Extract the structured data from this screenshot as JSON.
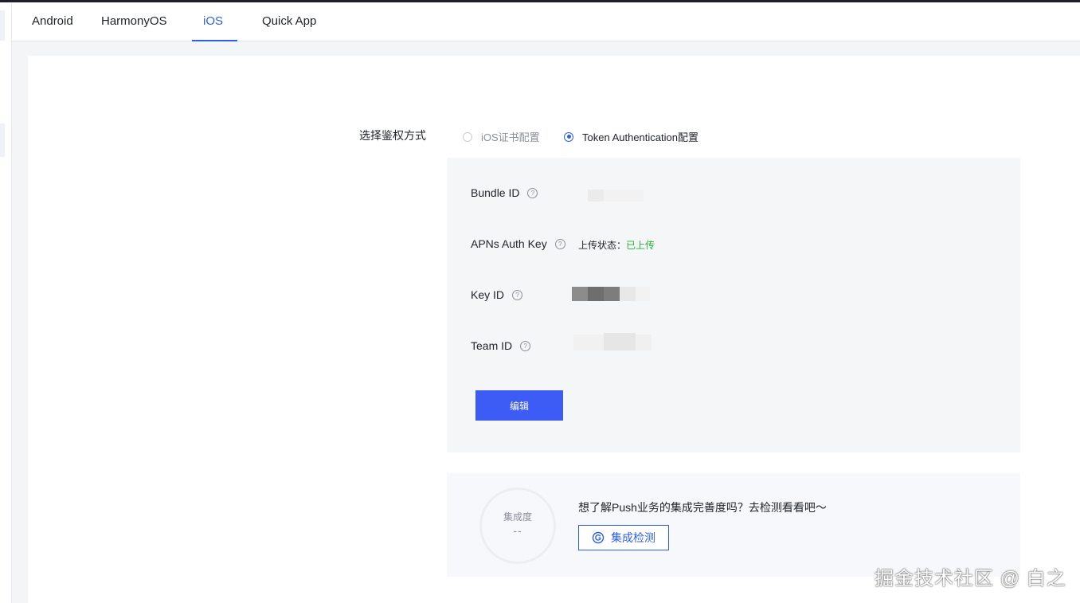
{
  "tabs": [
    {
      "label": "Android",
      "active": false
    },
    {
      "label": "HarmonyOS",
      "active": false
    },
    {
      "label": "iOS",
      "active": true
    },
    {
      "label": "Quick App",
      "active": false
    }
  ],
  "auth": {
    "label": "选择鉴权方式",
    "options": [
      {
        "label": "iOS证书配置",
        "checked": false
      },
      {
        "label": "Token Authentication配置",
        "checked": true
      }
    ]
  },
  "config": {
    "bundle_id_label": "Bundle ID",
    "apns_label": "APNs Auth Key",
    "upload_status_label": "上传状态：",
    "upload_status_value": "已上传",
    "key_id_label": "Key ID",
    "team_id_label": "Team ID",
    "edit_button": "编辑"
  },
  "integration": {
    "gauge_title": "集成度",
    "gauge_value": "--",
    "prompt": "想了解Push业务的集成完善度吗？去检测看看吧～",
    "check_button": "集成检测"
  },
  "watermark": "掘金技术社区 @ 白之",
  "colors": {
    "accent": "#2f5fe6",
    "primary_button": "#3d5cf5",
    "success": "#27ae3b"
  },
  "icons": {
    "help": "question-circle-icon",
    "check": "refresh-check-icon"
  }
}
